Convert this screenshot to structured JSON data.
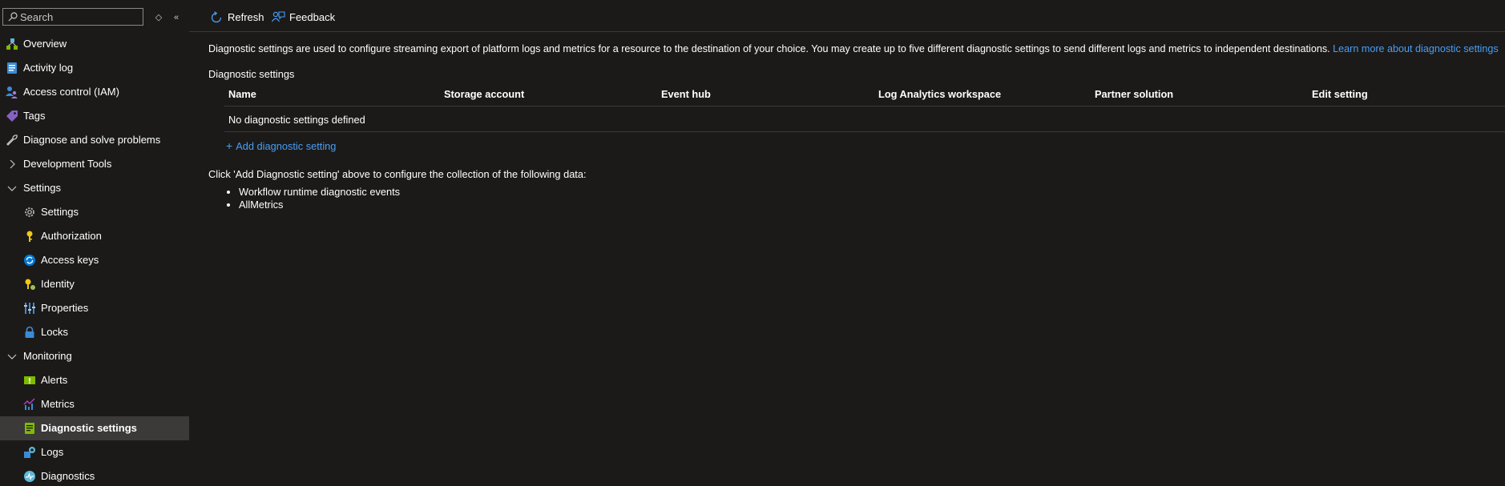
{
  "search": {
    "placeholder": "Search"
  },
  "sidebar": {
    "items": [
      {
        "label": "Overview",
        "icon": "overview-icon"
      },
      {
        "label": "Activity log",
        "icon": "activity-log-icon"
      },
      {
        "label": "Access control (IAM)",
        "icon": "access-control-icon"
      },
      {
        "label": "Tags",
        "icon": "tag-icon"
      },
      {
        "label": "Diagnose and solve problems",
        "icon": "wrench-icon"
      },
      {
        "label": "Development Tools",
        "icon": "chevron-right-icon"
      },
      {
        "label": "Settings",
        "icon": "chevron-down-icon"
      },
      {
        "label": "Settings",
        "icon": "gear-icon"
      },
      {
        "label": "Authorization",
        "icon": "key-icon"
      },
      {
        "label": "Access keys",
        "icon": "access-keys-icon"
      },
      {
        "label": "Identity",
        "icon": "identity-icon"
      },
      {
        "label": "Properties",
        "icon": "properties-icon"
      },
      {
        "label": "Locks",
        "icon": "lock-icon"
      },
      {
        "label": "Monitoring",
        "icon": "chevron-down-icon"
      },
      {
        "label": "Alerts",
        "icon": "alert-icon"
      },
      {
        "label": "Metrics",
        "icon": "metrics-icon"
      },
      {
        "label": "Diagnostic settings",
        "icon": "diagnostic-settings-icon"
      },
      {
        "label": "Logs",
        "icon": "logs-icon"
      },
      {
        "label": "Diagnostics",
        "icon": "diagnostics-icon"
      }
    ]
  },
  "toolbar": {
    "refresh_label": "Refresh",
    "feedback_label": "Feedback"
  },
  "main": {
    "description": "Diagnostic settings are used to configure streaming export of platform logs and metrics for a resource to the destination of your choice. You may create up to five different diagnostic settings to send different logs and metrics to independent destinations.",
    "learn_more": "Learn more about diagnostic settings",
    "section_title": "Diagnostic settings",
    "columns": [
      "Name",
      "Storage account",
      "Event hub",
      "Log Analytics workspace",
      "Partner solution",
      "Edit setting"
    ],
    "empty_row": "No diagnostic settings defined",
    "add_label": "Add diagnostic setting",
    "add_icon": "+",
    "note": "Click 'Add Diagnostic setting' above to configure the collection of the following data:",
    "data_items": [
      "Workflow runtime diagnostic events",
      "AllMetrics"
    ]
  },
  "colors": {
    "background": "#1b1a19",
    "link": "#479ef5",
    "active": "#3b3a39",
    "border": "#3b3a39"
  }
}
